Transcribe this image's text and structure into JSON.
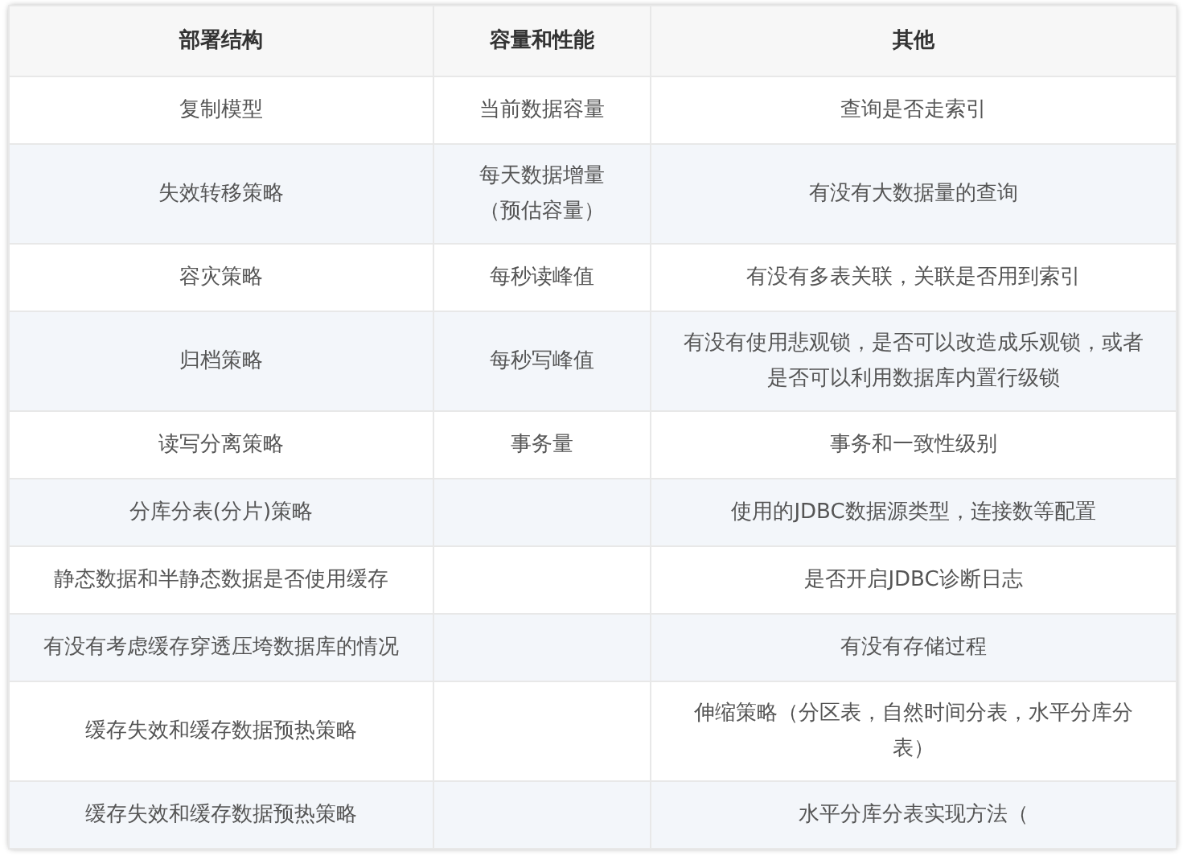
{
  "table": {
    "columns": [
      "部署结构",
      "容量和性能",
      "其他"
    ],
    "rows": [
      {
        "deployment": "复制模型",
        "capacity": "当前数据容量",
        "other": "查询是否走索引"
      },
      {
        "deployment": "失效转移策略",
        "capacity": "每天数据增量（预估容量）",
        "other": "有没有大数据量的查询"
      },
      {
        "deployment": "容灾策略",
        "capacity": "每秒读峰值",
        "other": "有没有多表关联，关联是否用到索引"
      },
      {
        "deployment": "归档策略",
        "capacity": "每秒写峰值",
        "other": "有没有使用悲观锁，是否可以改造成乐观锁，或者是否可以利用数据库内置行级锁"
      },
      {
        "deployment": "读写分离策略",
        "capacity": "事务量",
        "other": "事务和一致性级别"
      },
      {
        "deployment": "分库分表(分片)策略",
        "other": "使用的JDBC数据源类型，连接数等配置"
      },
      {
        "deployment": "静态数据和半静态数据是否使用缓存",
        "other": "是否开启JDBC诊断日志"
      },
      {
        "deployment": "有没有考虑缓存穿透压垮数据库的情况",
        "other": "有没有存储过程"
      },
      {
        "deployment": "缓存失效和缓存数据预热策略",
        "other": "伸缩策略（分区表，自然时间分表，水平分库分表）"
      },
      {
        "deployment": "缓存失效和缓存数据预热策略",
        "other": "水平分库分表实现方法（"
      }
    ]
  }
}
